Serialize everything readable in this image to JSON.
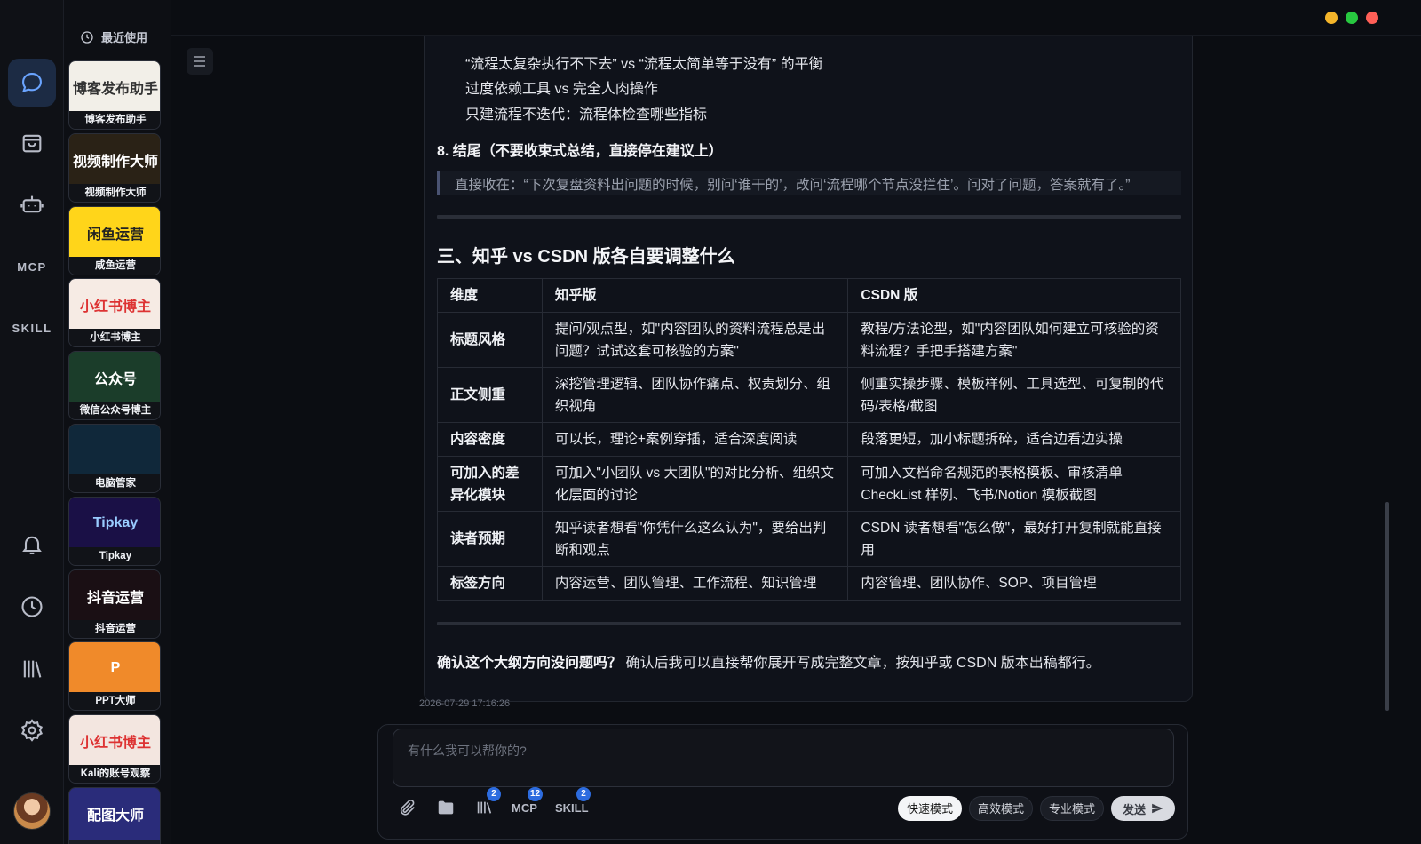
{
  "rail": {
    "mcp_label": "MCP",
    "skill_label": "SKILL"
  },
  "apps": {
    "recent_label": "最近使用",
    "items": [
      {
        "label": "博客发布助手",
        "thumb": "博客发布助手",
        "color": "#f2efe8",
        "text_color": "#333"
      },
      {
        "label": "视频制作大师",
        "thumb": "视频制作大师",
        "color": "#2a2216",
        "text_color": "#fff"
      },
      {
        "label": "咸鱼运营",
        "thumb": "闲鱼运营",
        "color": "#ffd51a",
        "text_color": "#222"
      },
      {
        "label": "小红书博主",
        "thumb": "小红书博主",
        "color": "#f6ebe4",
        "text_color": "#d33"
      },
      {
        "label": "微信公众号博主",
        "thumb": "公众号",
        "color": "#1b3d2a",
        "text_color": "#fff"
      },
      {
        "label": "电脑管家",
        "thumb": "",
        "color": "#10283a",
        "text_color": "#8ff"
      },
      {
        "label": "Tipkay",
        "thumb": "Tipkay",
        "color": "#1a1046",
        "text_color": "#9cf"
      },
      {
        "label": "抖音运营",
        "thumb": "抖音运营",
        "color": "#1a0f14",
        "text_color": "#fff"
      },
      {
        "label": "PPT大师",
        "thumb": "P",
        "color": "#f08a2a",
        "text_color": "#fff"
      },
      {
        "label": "Kali的账号观察",
        "thumb": "小红书博主",
        "color": "#f3e6e0",
        "text_color": "#d33"
      },
      {
        "label": "",
        "thumb": "配图大师",
        "color": "#2a2c7a",
        "text_color": "#fff"
      }
    ]
  },
  "message": {
    "lines": [
      "“流程太复杂执行不下去” vs “流程太简单等于没有” 的平衡",
      "过度依赖工具 vs 完全人肉操作",
      "只建流程不迭代：流程体检查哪些指标"
    ],
    "heading8": "8. 结尾（不要收束式总结，直接停在建议上）",
    "quote": "直接收在：“下次复盘资料出问题的时候，别问‘谁干的’，改问‘流程哪个节点没拦住’。问对了问题，答案就有了。”",
    "section_title": "三、知乎 vs CSDN 版各自要调整什么",
    "table": {
      "headers": [
        "维度",
        "知乎版",
        "CSDN 版"
      ],
      "rows": [
        [
          "标题风格",
          "提问/观点型，如\"内容团队的资料流程总是出问题？试试这套可核验的方案\"",
          "教程/方法论型，如\"内容团队如何建立可核验的资料流程？手把手搭建方案\""
        ],
        [
          "正文侧重",
          "深挖管理逻辑、团队协作痛点、权责划分、组织视角",
          "侧重实操步骤、模板样例、工具选型、可复制的代码/表格/截图"
        ],
        [
          "内容密度",
          "可以长，理论+案例穿插，适合深度阅读",
          "段落更短，加小标题拆碎，适合边看边实操"
        ],
        [
          "可加入的差异化模块",
          "可加入\"小团队 vs 大团队\"的对比分析、组织文化层面的讨论",
          "可加入文档命名规范的表格模板、审核清单 CheckList 样例、飞书/Notion 模板截图"
        ],
        [
          "读者预期",
          "知乎读者想看\"你凭什么这么认为\"，要给出判断和观点",
          "CSDN 读者想看\"怎么做\"，最好打开复制就能直接用"
        ],
        [
          "标签方向",
          "内容运营、团队管理、工作流程、知识管理",
          "内容管理、团队协作、SOP、项目管理"
        ]
      ]
    },
    "confirm_bold": "确认这个大纲方向没问题吗？",
    "confirm_rest": " 确认后我可以直接帮你展开写成完整文章，按知乎或 CSDN 版本出稿都行。",
    "timestamp": "2026-07-29 17:16:26"
  },
  "composer": {
    "placeholder": "有什么我可以帮你的?",
    "library_badge": "2",
    "mcp_label": "MCP",
    "mcp_badge": "12",
    "skill_label": "SKILL",
    "skill_badge": "2",
    "modes": [
      "快速模式",
      "高效模式",
      "专业模式"
    ],
    "active_mode": "快速模式",
    "send_label": "发送"
  },
  "colors": {
    "accent": "#2d6cdf",
    "traffic_yellow": "#f5b52a",
    "traffic_green": "#28c840",
    "traffic_red": "#ff5f57"
  }
}
